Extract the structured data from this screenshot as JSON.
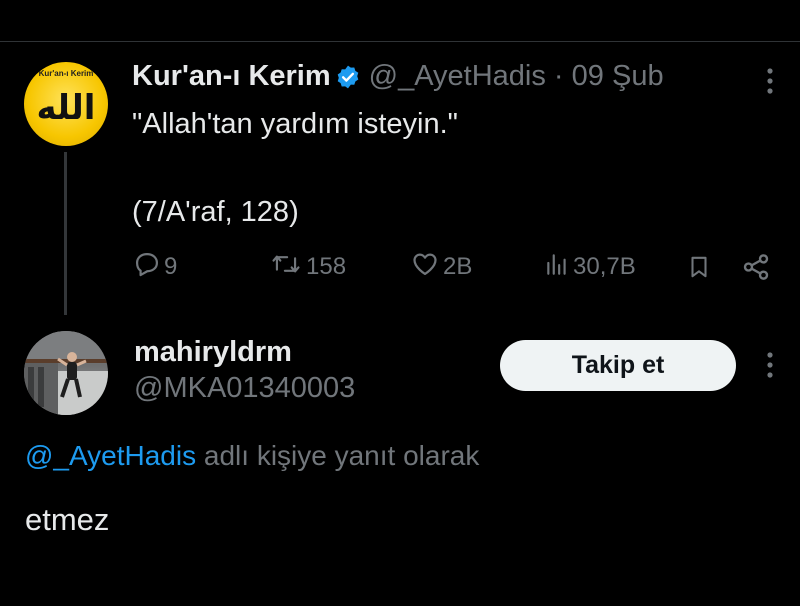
{
  "original_tweet": {
    "author_name": "Kur'an-ı Kerim",
    "author_handle": "@_AyetHadis",
    "date_sep": " · ",
    "date": "09 Şub",
    "avatar_caption": "Kur'an-ı Kerim",
    "avatar_calligraphy": "الله",
    "text": "\"Allah'tan yardım isteyin.\"",
    "reference": "(7/A'raf, 128)",
    "actions": {
      "replies": "9",
      "retweets": "158",
      "likes": "2B",
      "views": "30,7B"
    },
    "colors": {
      "verified": "#1d9bf0",
      "avatar_bg": "#f7c600"
    }
  },
  "reply": {
    "author_name": "mahiryldrm",
    "author_handle": "@MKA01340003",
    "follow_label": "Takip et",
    "reply_to_mention": "@_AyetHadis",
    "reply_to_suffix": " adlı kişiye yanıt olarak",
    "text": "etmez"
  },
  "colors": {
    "background": "#000000",
    "text_primary": "#e7e9ea",
    "text_secondary": "#71767b",
    "link": "#1d9bf0"
  }
}
